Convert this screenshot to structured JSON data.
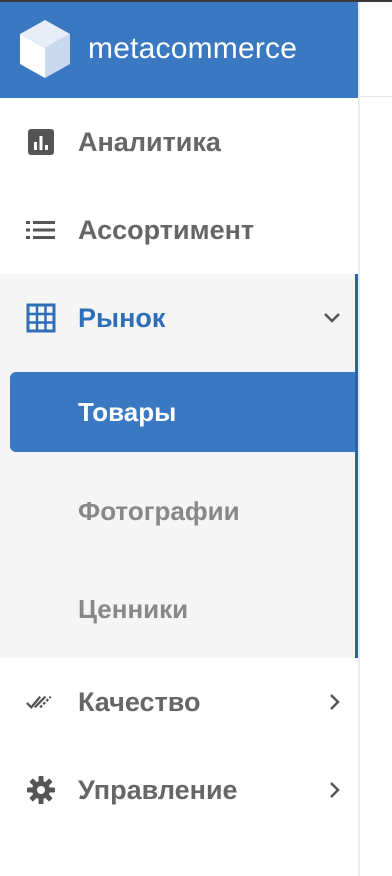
{
  "brand": {
    "name": "metacommerce",
    "logo_icon": "cube-logo-icon"
  },
  "nav": {
    "analytics": {
      "label": "Аналитика",
      "icon": "bar-chart-icon"
    },
    "assortment": {
      "label": "Ассортимент",
      "icon": "list-icon"
    },
    "market": {
      "label": "Рынок",
      "icon": "grid-table-icon",
      "expanded": true,
      "children": [
        {
          "label": "Товары",
          "active": true
        },
        {
          "label": "Фотографии",
          "active": false
        },
        {
          "label": "Ценники",
          "active": false
        }
      ]
    },
    "quality": {
      "label": "Качество",
      "icon": "double-check-icon"
    },
    "management": {
      "label": "Управление",
      "icon": "gear-icon"
    }
  },
  "colors": {
    "accent": "#3a78c2",
    "accent_dark": "#2c62a8",
    "text_muted": "#666666",
    "sub_muted": "#888888",
    "group_bg": "#f5f5f5"
  }
}
